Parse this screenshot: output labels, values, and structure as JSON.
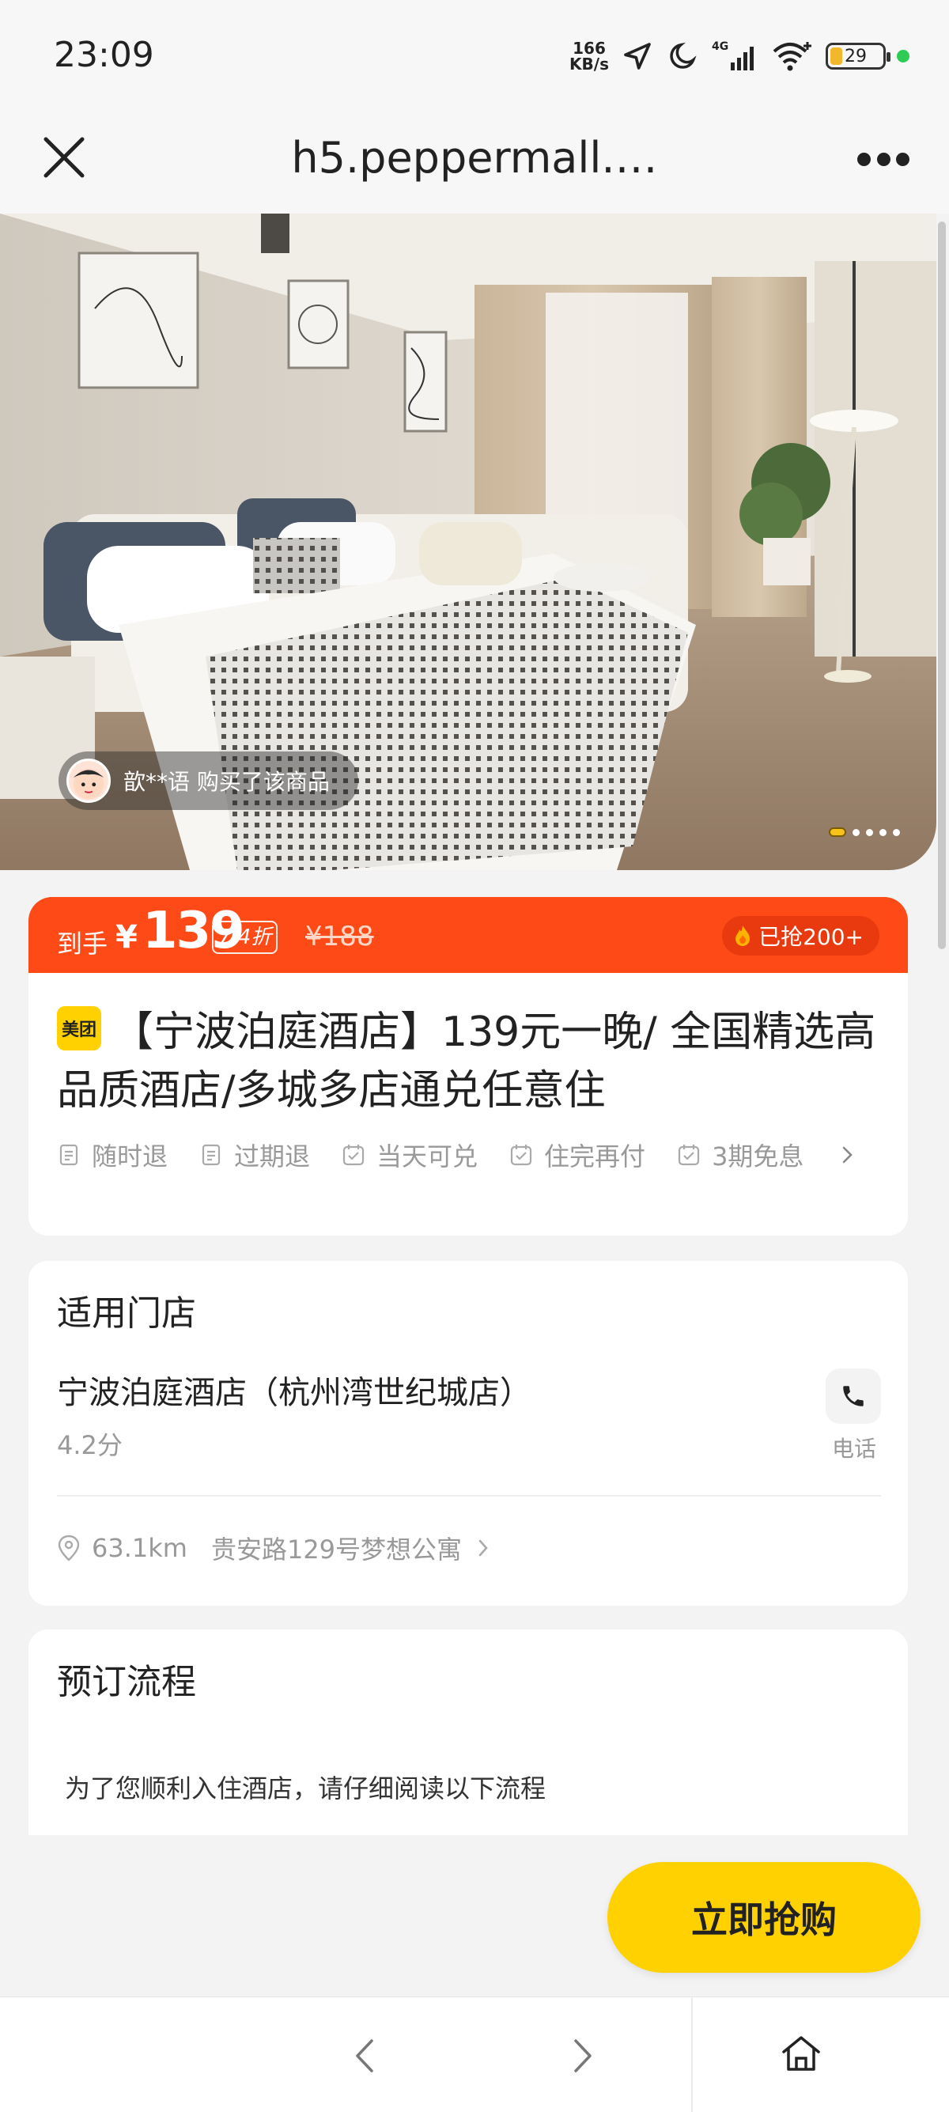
{
  "status_bar": {
    "time": "23:09",
    "net_speed_value": "166",
    "net_speed_unit": "KB/s",
    "network_type": "4G",
    "battery_level": "29",
    "icons": [
      "location-arrow-icon",
      "moon-icon",
      "signal-icon",
      "wifi-icon",
      "battery-icon"
    ]
  },
  "browser": {
    "url": "h5.peppermall.…",
    "close_icon": "close-icon",
    "more_icon": "more-icon"
  },
  "hero": {
    "buyer_text": "歆**语 购买了该商品",
    "carousel_count": 5,
    "carousel_active_index": 0
  },
  "price": {
    "prefix": "到手",
    "currency": "¥",
    "current": "139",
    "discount": "7.4折",
    "original": "¥188",
    "grabbed": "已抢200+",
    "colors": {
      "banner": "#fd4a17",
      "grabbed_pill": "#e83a0e"
    }
  },
  "product": {
    "brand_badge": "美团",
    "title": "【宁波泊庭酒店】139元一晚/ 全国精选高品质酒店/多城多店通兑任意住",
    "tags": [
      {
        "label": "随时退",
        "icon": "document-icon"
      },
      {
        "label": "过期退",
        "icon": "document-icon"
      },
      {
        "label": "当天可兑",
        "icon": "calendar-check-icon"
      },
      {
        "label": "住完再付",
        "icon": "calendar-check-icon"
      },
      {
        "label": "3期免息",
        "icon": "calendar-check-icon"
      }
    ]
  },
  "store": {
    "section_title": "适用门店",
    "name": "宁波泊庭酒店（杭州湾世纪城店）",
    "rating": "4.2分",
    "phone_label": "电话",
    "distance": "63.1km",
    "address": "贵安路129号梦想公寓"
  },
  "booking": {
    "section_title": "预订流程",
    "note": "为了您顺利入住酒店，请仔细阅读以下流程"
  },
  "cta": {
    "buy_label": "立即抢购",
    "color": "#ffd100"
  },
  "bottom_nav": {
    "icons": [
      "back-arrow-icon",
      "forward-arrow-icon",
      "home-icon"
    ]
  }
}
